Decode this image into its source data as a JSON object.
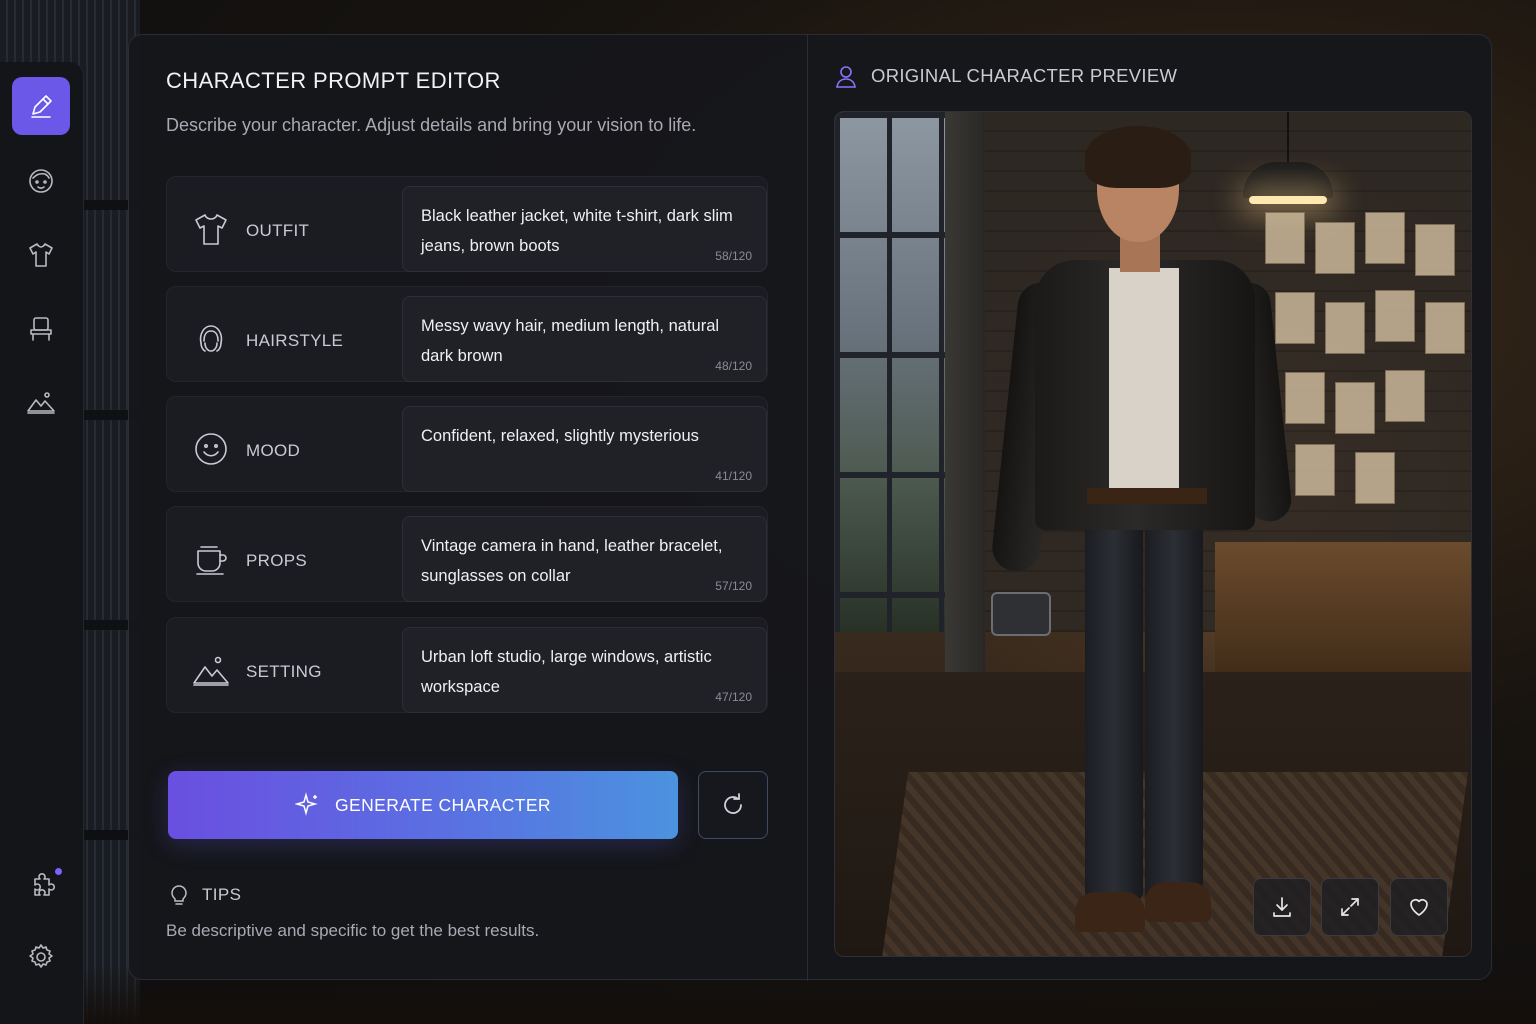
{
  "editor": {
    "title": "CHARACTER PROMPT EDITOR",
    "subtitle": "Describe your character. Adjust details and bring your vision to life.",
    "fields": [
      {
        "key": "outfit",
        "label": "OUTFIT",
        "icon": "tshirt-icon",
        "value": "Black leather jacket, white t-shirt, dark slim jeans, brown boots",
        "count": "58/120"
      },
      {
        "key": "hairstyle",
        "label": "HAIRSTYLE",
        "icon": "hair-icon",
        "value": "Messy wavy hair, medium length, natural dark brown",
        "count": "48/120"
      },
      {
        "key": "mood",
        "label": "MOOD",
        "icon": "smiley-icon",
        "value": "Confident, relaxed, slightly mysterious",
        "count": "41/120"
      },
      {
        "key": "props",
        "label": "PROPS",
        "icon": "cup-icon",
        "value": "Vintage camera in hand, leather bracelet, sunglasses on collar",
        "count": "57/120"
      },
      {
        "key": "setting",
        "label": "SETTING",
        "icon": "mountain-icon",
        "value": "Urban loft studio, large windows, artistic workspace",
        "count": "47/120"
      }
    ],
    "generate_label": "GENERATE CHARACTER",
    "tips_title": "TIPS",
    "tips_text": "Be descriptive and specific to get the best results."
  },
  "preview": {
    "title": "ORIGINAL CHARACTER PREVIEW",
    "actions": [
      "download-icon",
      "expand-icon",
      "heart-icon"
    ]
  },
  "sidebar": {
    "items": [
      "pencil-icon",
      "face-icon",
      "tshirt-icon",
      "chair-icon",
      "landscape-icon"
    ],
    "bottom": [
      "puzzle-icon",
      "gear-icon"
    ]
  },
  "colors": {
    "accent": "#6b57e8",
    "gradient_start": "#6a4fe0",
    "gradient_end": "#4b93df"
  }
}
